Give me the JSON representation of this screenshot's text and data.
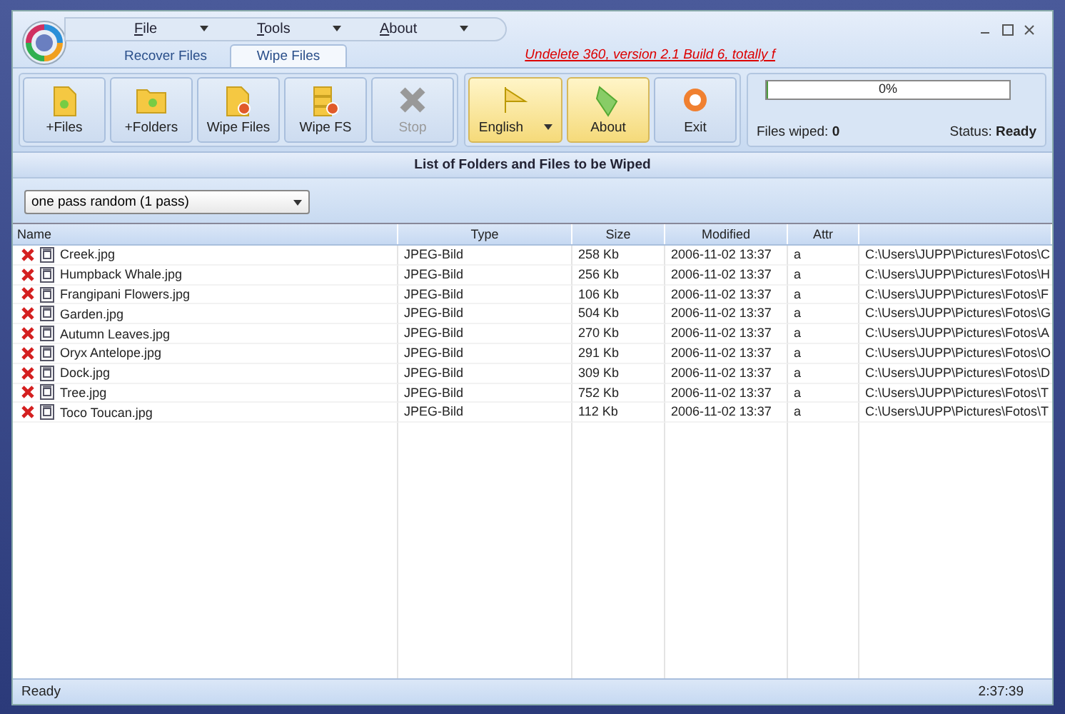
{
  "menu": [
    "File",
    "Tools",
    "About"
  ],
  "tabs": [
    {
      "label": "Recover Files",
      "selected": false
    },
    {
      "label": "Wipe Files",
      "selected": true
    }
  ],
  "banner_link": "Undelete 360, version 2.1 Build 6, totally f",
  "toolbar": [
    {
      "label": "+Files",
      "kind": "file",
      "disabled": false
    },
    {
      "label": "+Folders",
      "kind": "folder",
      "disabled": false
    },
    {
      "label": "Wipe Files",
      "kind": "wipefile",
      "disabled": false
    },
    {
      "label": "Wipe FS",
      "kind": "wipefs",
      "disabled": false
    },
    {
      "label": "Stop",
      "kind": "stop",
      "disabled": true
    }
  ],
  "actions": [
    {
      "label": "English",
      "kind": "language"
    },
    {
      "label": "About",
      "kind": "about"
    },
    {
      "label": "Exit",
      "kind": "exit"
    }
  ],
  "progress": {
    "text": "0%",
    "level": 0
  },
  "files_wiped": {
    "label": "Files wiped:",
    "value": "0"
  },
  "status": {
    "label": "Status:",
    "value": "Ready"
  },
  "list_title": "List of Folders and Files to be Wiped",
  "method": "one pass random (1 pass)",
  "table": {
    "columns": [
      "Name",
      "Type",
      "Size",
      "Modified",
      "Attr"
    ],
    "rows": [
      [
        "Creek.jpg",
        "JPEG-Bild",
        "258 Kb",
        "2006-11-02 13:37",
        "a",
        "C:\\Users\\JUPP\\Pictures\\Fotos\\C"
      ],
      [
        "Humpback Whale.jpg",
        "JPEG-Bild",
        "256 Kb",
        "2006-11-02 13:37",
        "a",
        "C:\\Users\\JUPP\\Pictures\\Fotos\\H"
      ],
      [
        "Frangipani Flowers.jpg",
        "JPEG-Bild",
        "106 Kb",
        "2006-11-02 13:37",
        "a",
        "C:\\Users\\JUPP\\Pictures\\Fotos\\F"
      ],
      [
        "Garden.jpg",
        "JPEG-Bild",
        "504 Kb",
        "2006-11-02 13:37",
        "a",
        "C:\\Users\\JUPP\\Pictures\\Fotos\\G"
      ],
      [
        "Autumn Leaves.jpg",
        "JPEG-Bild",
        "270 Kb",
        "2006-11-02 13:37",
        "a",
        "C:\\Users\\JUPP\\Pictures\\Fotos\\A"
      ],
      [
        "Oryx Antelope.jpg",
        "JPEG-Bild",
        "291 Kb",
        "2006-11-02 13:37",
        "a",
        "C:\\Users\\JUPP\\Pictures\\Fotos\\O"
      ],
      [
        "Dock.jpg",
        "JPEG-Bild",
        "309 Kb",
        "2006-11-02 13:37",
        "a",
        "C:\\Users\\JUPP\\Pictures\\Fotos\\D"
      ],
      [
        "Tree.jpg",
        "JPEG-Bild",
        "752 Kb",
        "2006-11-02 13:37",
        "a",
        "C:\\Users\\JUPP\\Pictures\\Fotos\\T"
      ],
      [
        "Toco Toucan.jpg",
        "JPEG-Bild",
        "112 Kb",
        "2006-11-02 13:37",
        "a",
        "C:\\Users\\JUPP\\Pictures\\Fotos\\T"
      ]
    ]
  },
  "status_bar": {
    "text": "Ready",
    "time": "2:37:39"
  }
}
